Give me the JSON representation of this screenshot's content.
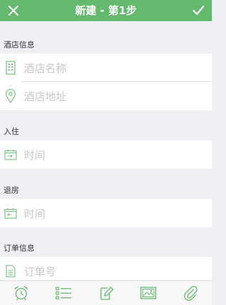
{
  "navbar": {
    "title": "新建 - 第1步",
    "close_icon": "close-icon",
    "confirm_icon": "checkmark-icon"
  },
  "sections": {
    "hotel": {
      "label": "酒店信息",
      "name_placeholder": "酒店名称",
      "address_placeholder": "酒店地址"
    },
    "checkin": {
      "label": "入住",
      "time_placeholder": "时间"
    },
    "checkout": {
      "label": "退房",
      "time_placeholder": "时间"
    },
    "order": {
      "label": "订单信息",
      "number_placeholder": "订单号"
    }
  },
  "tabbar": {
    "items": [
      "alarm-icon",
      "list-icon",
      "edit-icon",
      "image-icon",
      "attachment-icon"
    ]
  },
  "colors": {
    "accent": "#63ba6e",
    "background": "#efeff4",
    "placeholder": "#c7c7cc"
  }
}
